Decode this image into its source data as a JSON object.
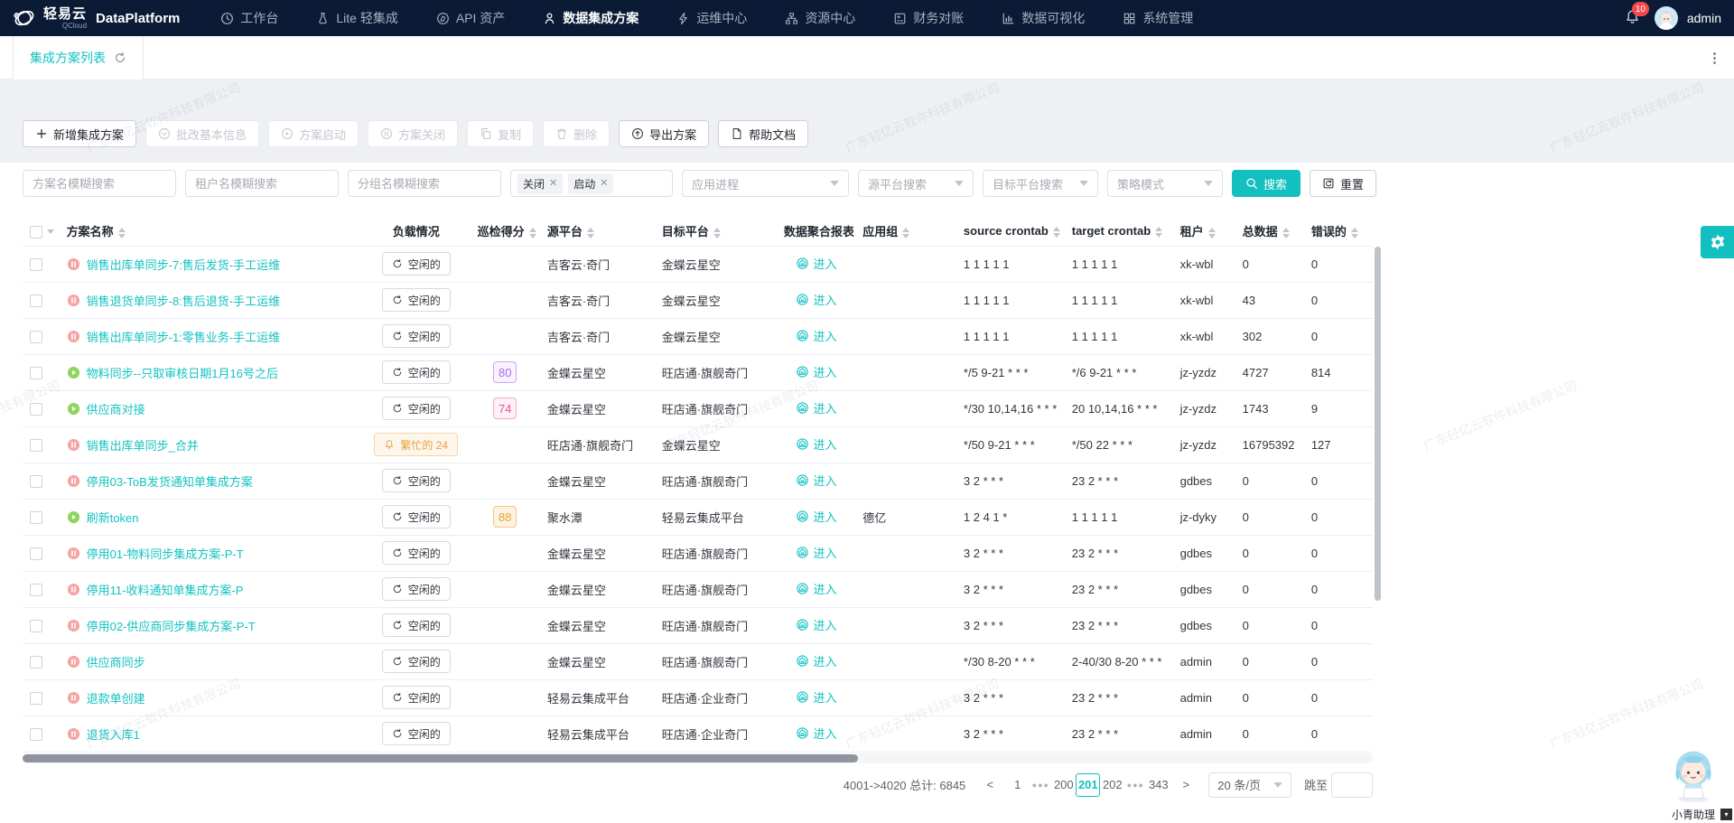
{
  "navbar": {
    "brand": {
      "logo_text": "轻易云",
      "logo_sub": "QCloud",
      "product": "DataPlatform"
    },
    "menu": [
      {
        "label": "工作台",
        "icon": "clock-icon",
        "active": false
      },
      {
        "label": "Lite 轻集成",
        "icon": "flask-icon",
        "active": false
      },
      {
        "label": "API 资产",
        "icon": "api-icon",
        "active": false
      },
      {
        "label": "数据集成方案",
        "icon": "person-icon",
        "active": true
      },
      {
        "label": "运维中心",
        "icon": "bolt-icon",
        "active": false
      },
      {
        "label": "资源中心",
        "icon": "sitemap-icon",
        "active": false
      },
      {
        "label": "财务对账",
        "icon": "ledger-icon",
        "active": false
      },
      {
        "label": "数据可视化",
        "icon": "chart-icon",
        "active": false
      },
      {
        "label": "系统管理",
        "icon": "grid-icon",
        "active": false
      }
    ],
    "notification_count": "10",
    "user": "admin"
  },
  "tabbar": {
    "active_tab": "集成方案列表"
  },
  "toolbar": {
    "buttons": [
      {
        "label": "新增集成方案",
        "icon": "plus-icon",
        "enabled": true
      },
      {
        "label": "批改基本信息",
        "icon": "circle-caret-icon",
        "enabled": false
      },
      {
        "label": "方案启动",
        "icon": "play-circle-icon",
        "enabled": false
      },
      {
        "label": "方案关闭",
        "icon": "pause-circle-icon",
        "enabled": false
      },
      {
        "label": "复制",
        "icon": "copy-icon",
        "enabled": false
      },
      {
        "label": "删除",
        "icon": "trash-icon",
        "enabled": false
      },
      {
        "label": "导出方案",
        "icon": "export-icon",
        "enabled": true
      },
      {
        "label": "帮助文档",
        "icon": "doc-icon",
        "enabled": true
      }
    ]
  },
  "filters": {
    "inputs": [
      {
        "placeholder": "方案名模糊搜索"
      },
      {
        "placeholder": "租户名模糊搜索"
      },
      {
        "placeholder": "分组名模糊搜索"
      }
    ],
    "status_tags": [
      "关闭",
      "启动"
    ],
    "selects": [
      {
        "placeholder": "应用进程",
        "size": "lg"
      },
      {
        "placeholder": "源平台搜索",
        "size": "sm"
      },
      {
        "placeholder": "目标平台搜索",
        "size": "sm"
      },
      {
        "placeholder": "策略模式",
        "size": "sm"
      }
    ],
    "search_label": "搜索",
    "reset_label": "重置"
  },
  "table": {
    "columns": [
      {
        "label": "方案名称",
        "sortable": true
      },
      {
        "label": "负载情况",
        "sortable": false
      },
      {
        "label": "巡检得分",
        "sortable": true
      },
      {
        "label": "源平台",
        "sortable": true
      },
      {
        "label": "目标平台",
        "sortable": true
      },
      {
        "label": "数据聚合报表",
        "sortable": false
      },
      {
        "label": "应用组",
        "sortable": true
      },
      {
        "label": "source crontab",
        "sortable": true
      },
      {
        "label": "target crontab",
        "sortable": true
      },
      {
        "label": "租户",
        "sortable": true
      },
      {
        "label": "总数据",
        "sortable": true
      },
      {
        "label": "错误的",
        "sortable": true
      }
    ],
    "enter_label": "进入",
    "rows": [
      {
        "name": "销售出库单同步-7:售后发货-手工运维",
        "status": "paused",
        "load": "idle",
        "load_label": "空闲的",
        "score": "",
        "score_color": "",
        "source": "吉客云·奇门",
        "target": "金蝶云星空",
        "group": "",
        "source_crontab": "1 1 1 1 1",
        "target_crontab": "1 1 1 1 1",
        "tenant": "xk-wbl",
        "total": "0",
        "errors": "0"
      },
      {
        "name": "销售退货单同步-8:售后退货-手工运维",
        "status": "paused",
        "load": "idle",
        "load_label": "空闲的",
        "score": "",
        "score_color": "",
        "source": "吉客云·奇门",
        "target": "金蝶云星空",
        "group": "",
        "source_crontab": "1 1 1 1 1",
        "target_crontab": "1 1 1 1 1",
        "tenant": "xk-wbl",
        "total": "43",
        "errors": "0"
      },
      {
        "name": "销售出库单同步-1:零售业务-手工运维",
        "status": "paused",
        "load": "idle",
        "load_label": "空闲的",
        "score": "",
        "score_color": "",
        "source": "吉客云·奇门",
        "target": "金蝶云星空",
        "group": "",
        "source_crontab": "1 1 1 1 1",
        "target_crontab": "1 1 1 1 1",
        "tenant": "xk-wbl",
        "total": "302",
        "errors": "0"
      },
      {
        "name": "物料同步--只取审核日期1月16号之后",
        "status": "running",
        "load": "idle",
        "load_label": "空闲的",
        "score": "80",
        "score_color": "purple",
        "source": "金蝶云星空",
        "target": "旺店通·旗舰奇门",
        "group": "",
        "source_crontab": "*/5 9-21 * * *",
        "target_crontab": "*/6 9-21 * * *",
        "tenant": "jz-yzdz",
        "total": "4727",
        "errors": "814"
      },
      {
        "name": "供应商对接",
        "status": "running",
        "load": "idle",
        "load_label": "空闲的",
        "score": "74",
        "score_color": "pink",
        "source": "金蝶云星空",
        "target": "旺店通·旗舰奇门",
        "group": "",
        "source_crontab": "*/30 10,14,16 * * *",
        "target_crontab": "20 10,14,16 * * *",
        "tenant": "jz-yzdz",
        "total": "1743",
        "errors": "9"
      },
      {
        "name": "销售出库单同步_合并",
        "status": "paused",
        "load": "busy",
        "load_label": "繁忙的 24",
        "score": "",
        "score_color": "",
        "source": "旺店通·旗舰奇门",
        "target": "金蝶云星空",
        "group": "",
        "source_crontab": "*/50 9-21 * * *",
        "target_crontab": "*/50 22 * * *",
        "tenant": "jz-yzdz",
        "total": "16795392",
        "errors": "127"
      },
      {
        "name": "停用03-ToB发货通知单集成方案",
        "status": "paused",
        "load": "idle",
        "load_label": "空闲的",
        "score": "",
        "score_color": "",
        "source": "金蝶云星空",
        "target": "旺店通·旗舰奇门",
        "group": "",
        "source_crontab": "3 2 * * *",
        "target_crontab": "23 2 * * *",
        "tenant": "gdbes",
        "total": "0",
        "errors": "0"
      },
      {
        "name": "刷新token",
        "status": "running",
        "load": "idle",
        "load_label": "空闲的",
        "score": "88",
        "score_color": "orange",
        "source": "聚水潭",
        "target": "轻易云集成平台",
        "group": "德亿",
        "source_crontab": "1 2 4 1 *",
        "target_crontab": "1 1 1 1 1",
        "tenant": "jz-dyky",
        "total": "0",
        "errors": "0"
      },
      {
        "name": "停用01-物料同步集成方案-P-T",
        "status": "paused",
        "load": "idle",
        "load_label": "空闲的",
        "score": "",
        "score_color": "",
        "source": "金蝶云星空",
        "target": "旺店通·旗舰奇门",
        "group": "",
        "source_crontab": "3 2 * * *",
        "target_crontab": "23 2 * * *",
        "tenant": "gdbes",
        "total": "0",
        "errors": "0"
      },
      {
        "name": "停用11-收料通知单集成方案-P",
        "status": "paused",
        "load": "idle",
        "load_label": "空闲的",
        "score": "",
        "score_color": "",
        "source": "金蝶云星空",
        "target": "旺店通·旗舰奇门",
        "group": "",
        "source_crontab": "3 2 * * *",
        "target_crontab": "23 2 * * *",
        "tenant": "gdbes",
        "total": "0",
        "errors": "0"
      },
      {
        "name": "停用02-供应商同步集成方案-P-T",
        "status": "paused",
        "load": "idle",
        "load_label": "空闲的",
        "score": "",
        "score_color": "",
        "source": "金蝶云星空",
        "target": "旺店通·旗舰奇门",
        "group": "",
        "source_crontab": "3 2 * * *",
        "target_crontab": "23 2 * * *",
        "tenant": "gdbes",
        "total": "0",
        "errors": "0"
      },
      {
        "name": "供应商同步",
        "status": "paused",
        "load": "idle",
        "load_label": "空闲的",
        "score": "",
        "score_color": "",
        "source": "金蝶云星空",
        "target": "旺店通·旗舰奇门",
        "group": "",
        "source_crontab": "*/30 8-20 * * *",
        "target_crontab": "2-40/30 8-20 * * *",
        "tenant": "admin",
        "total": "0",
        "errors": "0"
      },
      {
        "name": "退款单创建",
        "status": "paused",
        "load": "idle",
        "load_label": "空闲的",
        "score": "",
        "score_color": "",
        "source": "轻易云集成平台",
        "target": "旺店通·企业奇门",
        "group": "",
        "source_crontab": "3 2 * * *",
        "target_crontab": "23 2 * * *",
        "tenant": "admin",
        "total": "0",
        "errors": "0"
      },
      {
        "name": "退货入库1",
        "status": "paused",
        "load": "idle",
        "load_label": "空闲的",
        "score": "",
        "score_color": "",
        "source": "轻易云集成平台",
        "target": "旺店通·企业奇门",
        "group": "",
        "source_crontab": "3 2 * * *",
        "target_crontab": "23 2 * * *",
        "tenant": "admin",
        "total": "0",
        "errors": "0"
      }
    ]
  },
  "pagination": {
    "summary": "4001->4020 总计: 6845",
    "pages": [
      "1",
      "...",
      "200",
      "201",
      "202",
      "...",
      "343"
    ],
    "current": "201",
    "page_size": "20 条/页",
    "jump_label": "跳至",
    "jump_value": ""
  },
  "assistant": {
    "label": "小青助理"
  },
  "watermark": "广东轻亿云软件科技有限公司",
  "colors": {
    "accent": "#13bfbf",
    "navbar": "#0b1b36",
    "badge": "#f5484d",
    "busy": "#e6a23c"
  }
}
